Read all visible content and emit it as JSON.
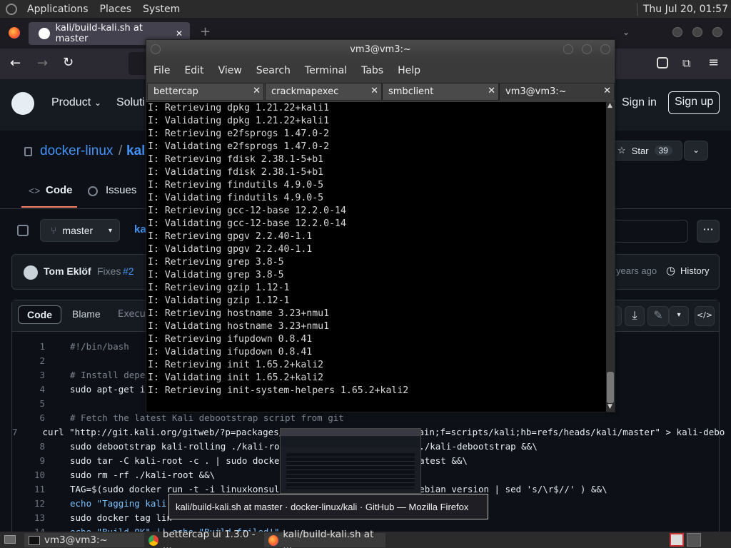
{
  "top_panel": {
    "menus": [
      "Applications",
      "Places",
      "System"
    ],
    "clock": "Thu Jul 20, 01:57"
  },
  "firefox": {
    "tab_title": "kali/build-kali.sh at master",
    "close_glyph": "✕",
    "new_tab_glyph": "+"
  },
  "github": {
    "nav_product": "Product",
    "nav_solutions": "Soluti",
    "sign_in": "Sign in",
    "sign_up": "Sign up",
    "repo_owner": "docker-linux",
    "repo_sep": "/",
    "repo_name": "kali",
    "star_label": "Star",
    "star_count": "39",
    "tab_code": "Code",
    "tab_issues": "Issues",
    "branch": "master",
    "file_crumb": "ka",
    "commit_author": "Tom Eklöf",
    "commit_msg": "Fixes",
    "commit_ref": "#2",
    "commit_age": "years ago",
    "history": "History",
    "view_code": "Code",
    "view_blame": "Blame",
    "view_exec": "Executa",
    "lines": [
      {
        "n": "1",
        "t": "#!/bin/bash"
      },
      {
        "n": "2",
        "t": ""
      },
      {
        "n": "3",
        "t": "# Install deper"
      },
      {
        "n": "4",
        "t": "sudo apt-get ir"
      },
      {
        "n": "5",
        "t": ""
      },
      {
        "n": "6",
        "t": "# Fetch the latest Kali debootstrap script from git"
      },
      {
        "n": "7",
        "t": "curl \"http://git.kali.org/gitweb/?p=packages/debootstrap.git;a=blob_plain;f=scripts/kali;hb=refs/heads/kali/master\" > kali-debo"
      },
      {
        "n": "8",
        "t": "sudo debootstrap kali-rolling ./kali-root                        ./kali-debootstrap &&\\"
      },
      {
        "n": "9",
        "t": "sudo tar -C kali-root -c . | sudo docker                         atest &&\\"
      },
      {
        "n": "10",
        "t": "sudo rm -rf ./kali-root &&\\"
      },
      {
        "n": "11",
        "t": "TAG=$(sudo docker run -t -i linuxkonsult/                       debian_version | sed 's/\\r$//' ) &&\\"
      },
      {
        "n": "12",
        "t": "echo \"Tagging kali"
      },
      {
        "n": "13",
        "t": "sudo docker tag lin"
      },
      {
        "n": "14",
        "t": "echo \"Build OK\" || echo \"Build failed!\""
      }
    ]
  },
  "terminal": {
    "title": "vm3@vm3:~",
    "menu": [
      "File",
      "Edit",
      "View",
      "Search",
      "Terminal",
      "Tabs",
      "Help"
    ],
    "tabs": [
      "bettercap",
      "crackmapexec",
      "smbclient",
      "vm3@vm3:~"
    ],
    "output": [
      "I: Retrieving dpkg 1.21.22+kali1",
      "I: Validating dpkg 1.21.22+kali1",
      "I: Retrieving e2fsprogs 1.47.0-2",
      "I: Validating e2fsprogs 1.47.0-2",
      "I: Retrieving fdisk 2.38.1-5+b1",
      "I: Validating fdisk 2.38.1-5+b1",
      "I: Retrieving findutils 4.9.0-5",
      "I: Validating findutils 4.9.0-5",
      "I: Retrieving gcc-12-base 12.2.0-14",
      "I: Validating gcc-12-base 12.2.0-14",
      "I: Retrieving gpgv 2.2.40-1.1",
      "I: Validating gpgv 2.2.40-1.1",
      "I: Retrieving grep 3.8-5",
      "I: Validating grep 3.8-5",
      "I: Retrieving gzip 1.12-1",
      "I: Validating gzip 1.12-1",
      "I: Retrieving hostname 3.23+nmu1",
      "I: Validating hostname 3.23+nmu1",
      "I: Retrieving ifupdown 0.8.41",
      "I: Validating ifupdown 0.8.41",
      "I: Retrieving init 1.65.2+kali2",
      "I: Validating init 1.65.2+kali2",
      "I: Retrieving init-system-helpers 1.65.2+kali2"
    ]
  },
  "tooltip": "kali/build-kali.sh at master · docker-linux/kali · GitHub — Mozilla Firefox",
  "taskbar": {
    "items": [
      "vm3@vm3:~",
      "bettercap ui 1.3.0 - ...",
      "kali/build-kali.sh at ..."
    ]
  },
  "colors": {
    "github_bg": "#0d1117",
    "github_header": "#161b22",
    "link_blue": "#4493f8",
    "terminal_bg": "#000000",
    "panel_bg": "#2b2b2b"
  }
}
